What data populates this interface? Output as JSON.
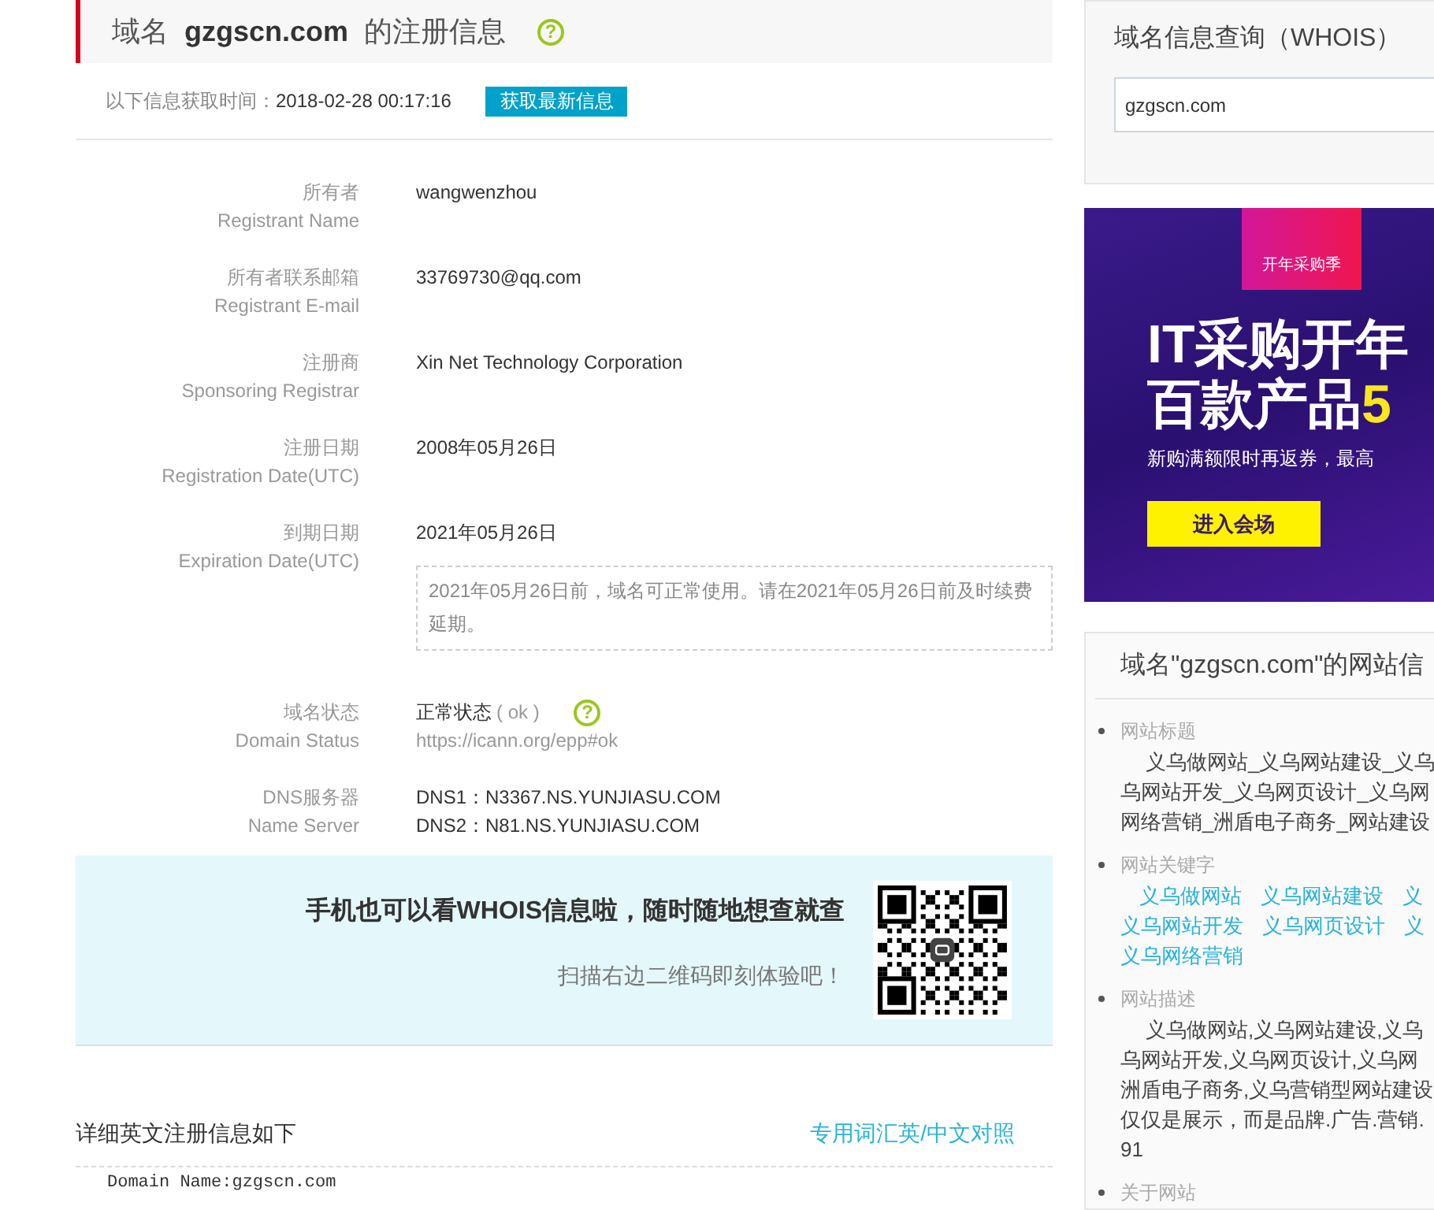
{
  "header": {
    "prefix": "域名",
    "domain": "gzgscn.com",
    "suffix": "的注册信息",
    "help": "?"
  },
  "fetch": {
    "label": "以下信息获取时间：",
    "time": "2018-02-28 00:17:16",
    "button": "获取最新信息"
  },
  "fields": [
    {
      "kind": "text",
      "label_cn": "所有者",
      "label_en": "Registrant Name",
      "value": "wangwenzhou"
    },
    {
      "kind": "text",
      "label_cn": "所有者联系邮箱",
      "label_en": "Registrant E-mail",
      "value": "33769730@qq.com"
    },
    {
      "kind": "text",
      "label_cn": "注册商",
      "label_en": "Sponsoring Registrar",
      "value": "Xin Net Technology Corporation"
    },
    {
      "kind": "text",
      "label_cn": "注册日期",
      "label_en": "Registration Date(UTC)",
      "value": "2008年05月26日"
    },
    {
      "kind": "notice",
      "label_cn": "到期日期",
      "label_en": "Expiration Date(UTC)",
      "value": "2021年05月26日",
      "notice": "2021年05月26日前，域名可正常使用。请在2021年05月26日前及时续费延期。"
    },
    {
      "kind": "status",
      "label_cn": "域名状态",
      "label_en": "Domain Status",
      "value": "正常状态",
      "code": "( ok )",
      "help": "?",
      "link": "https://icann.org/epp#ok"
    },
    {
      "kind": "lines",
      "label_cn": "DNS服务器",
      "label_en": "Name Server",
      "lines": [
        "DNS1：N3367.NS.YUNJIASU.COM",
        "DNS2：N81.NS.YUNJIASU.COM"
      ]
    }
  ],
  "promo": {
    "title": "手机也可以看WHOIS信息啦，随时随地想查就查",
    "subtitle": "扫描右边二维码即刻体验吧！"
  },
  "detail": {
    "title": "详细英文注册信息如下",
    "link": "专用词汇英/中文对照",
    "lines": [
      "Domain Name:gzgscn.com"
    ]
  },
  "whois_box": {
    "title": "域名信息查询（WHOIS）",
    "value": "gzgscn.com"
  },
  "ad": {
    "badge": "开年采购季",
    "headline_1": "IT采购开年",
    "headline_2": "百款产品",
    "headline_2_highlight": "5",
    "sub": "新购满额限时再返券，最高",
    "button": "进入会场"
  },
  "site_info": {
    "title": "域名\"gzgscn.com\"的网站信",
    "sections": [
      {
        "kind": "text",
        "label": "网站标题",
        "lines": [
          "义乌做网站_义乌网站建设_义乌",
          "乌网站开发_义乌网页设计_义乌网",
          "网络营销_洲盾电子商务_网站建设"
        ]
      },
      {
        "kind": "keywords",
        "label": "网站关键字",
        "rows": [
          [
            "义乌做网站",
            "义乌网站建设",
            "义"
          ],
          [
            "义乌网站开发",
            "义乌网页设计",
            "义"
          ],
          [
            "义乌网络营销"
          ]
        ]
      },
      {
        "kind": "text",
        "label": "网站描述",
        "lines": [
          "义乌做网站,义乌网站建设,义乌",
          "乌网站开发,义乌网页设计,义乌网",
          "洲盾电子商务,义乌营销型网站建设",
          "仅仅是展示，而是品牌.广告.营销.",
          "91"
        ]
      },
      {
        "kind": "text",
        "label": "关于网站"
      }
    ]
  }
}
